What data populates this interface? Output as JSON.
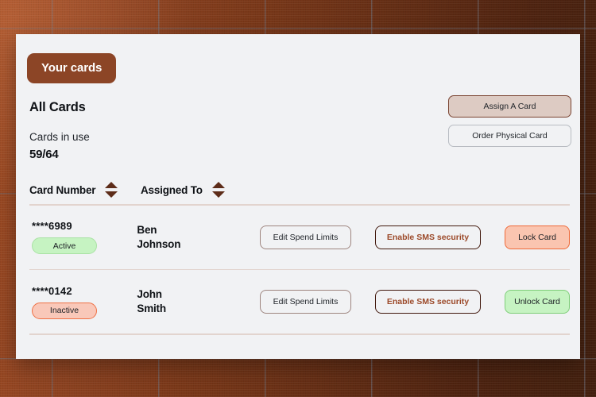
{
  "panel": {
    "title_badge": "Your cards",
    "section_title": "All Cards",
    "cards_in_use_label": "Cards in use",
    "cards_in_use_value": "59/64"
  },
  "top_actions": {
    "assign_card": "Assign A Card",
    "order_physical_card": "Order Physical Card"
  },
  "table": {
    "headers": [
      {
        "label": "Card Number",
        "sort_icon": "sort-updown-icon"
      },
      {
        "label": "Assigned To",
        "sort_icon": "sort-updown-icon"
      }
    ],
    "rows": [
      {
        "card_number": "****6989",
        "status": "Active",
        "status_kind": "active",
        "assigned_first": "Ben",
        "assigned_last": "Johnson",
        "actions": {
          "edit": "Edit Spend Limits",
          "sms": "Enable SMS security",
          "lock": "Lock Card"
        }
      },
      {
        "card_number": "****0142",
        "status": "Inactive",
        "status_kind": "inactive",
        "assigned_first": "John",
        "assigned_last": "Smith",
        "actions": {
          "edit": "Edit Spend Limits",
          "sms": "Enable SMS security",
          "lock": "Unlock Card"
        }
      }
    ]
  },
  "colors": {
    "brand_brown": "#8c4526",
    "panel_bg": "#f1f2f4",
    "wall_light": "#a04c24",
    "wall_dark": "#43200f",
    "divider": "#e2d4ce",
    "active_green": "#c6f3c2",
    "inactive_peach": "#f9c8b9",
    "assign_btn_bg": "#ddcbc3",
    "sms_text": "#9c4a2a"
  }
}
